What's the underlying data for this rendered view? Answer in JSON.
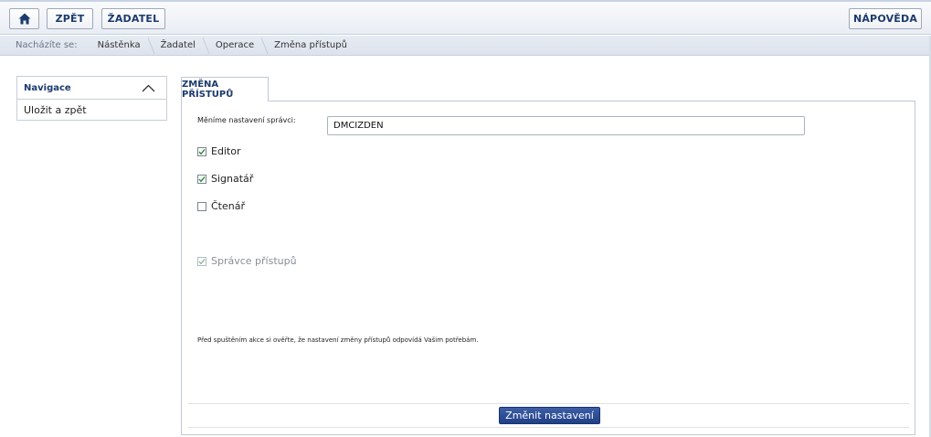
{
  "toolbar": {
    "home_icon": "home-icon",
    "back_label": "ZPĚT",
    "applicant_label": "ŽADATEL",
    "help_label": "NÁPOVĚDA"
  },
  "breadcrumb": {
    "label": "Nacházíte se:",
    "items": [
      "Nástěnka",
      "Žadatel",
      "Operace",
      "Změna přístupů"
    ]
  },
  "navigation": {
    "title": "Navigace",
    "toggle_icon": "chevron-up-icon",
    "items": [
      "Uložit a zpět"
    ]
  },
  "tab": {
    "label": "ZMĚNA PŘÍSTUPŮ"
  },
  "form": {
    "field_label": "Měníme nastavení správci:",
    "field_value": "DMCIZDEN",
    "checkboxes": [
      {
        "label": "Editor",
        "checked": true,
        "disabled": false
      },
      {
        "label": "Signatář",
        "checked": true,
        "disabled": false
      },
      {
        "label": "Čtenář",
        "checked": false,
        "disabled": false
      },
      {
        "label": "Správce přístupů",
        "checked": true,
        "disabled": true
      }
    ],
    "note": "Před spuštěním akce si ověřte, že nastavení změny přístupů odpovídá Vašim potřebám.",
    "submit_label": "Změnit nastavení"
  },
  "colors": {
    "accent": "#1c3a6e",
    "primary_button": "#203f86",
    "check": "#2e8b3a"
  }
}
